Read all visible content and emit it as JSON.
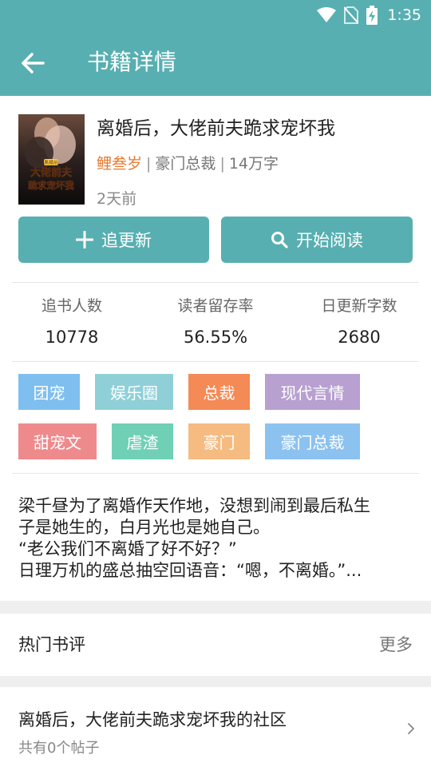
{
  "status": {
    "time": "1:35"
  },
  "header": {
    "title": "书籍详情",
    "back_icon": "arrow-left-icon"
  },
  "book": {
    "title": "离婚后，大佬前夫跪求宠坏我",
    "author": "鲤叁岁",
    "category": "豪门总裁",
    "word_count": "14万字",
    "updated": "2天前",
    "cover": {
      "badge": "离婚后",
      "line1": "大佬前夫",
      "line2": "跪求宠坏我"
    }
  },
  "actions": {
    "follow_label": "追更新",
    "read_label": "开始阅读"
  },
  "stats": [
    {
      "label": "追书人数",
      "value": "10778"
    },
    {
      "label": "读者留存率",
      "value": "56.55%"
    },
    {
      "label": "日更新字数",
      "value": "2680"
    }
  ],
  "tags": [
    {
      "label": "团宠",
      "color": "#7fbff0"
    },
    {
      "label": "娱乐圈",
      "color": "#8fd0d8"
    },
    {
      "label": "总裁",
      "color": "#f48a55"
    },
    {
      "label": "现代言情",
      "color": "#b8a0d0"
    },
    {
      "label": "甜宠文",
      "color": "#ef8a8c"
    },
    {
      "label": "虐渣",
      "color": "#6fd0b6"
    },
    {
      "label": "豪门",
      "color": "#f5bb80"
    },
    {
      "label": "豪门总裁",
      "color": "#8cc2ef"
    }
  ],
  "synopsis": {
    "lines": [
      "梁千昼为了离婚作天作地，没想到闹到最后私生",
      "子是她生的，白月光也是她自己。",
      "“老公我们不离婚了好不好？”",
      "日理万机的盛总抽空回语音：“嗯，不离婚。”..."
    ]
  },
  "reviews": {
    "title": "热门书评",
    "more_label": "更多"
  },
  "community": {
    "title": "离婚后，大佬前夫跪求宠坏我的社区",
    "subtitle": "共有0个帖子"
  },
  "colors": {
    "primary": "#58afb1",
    "author": "#e57a30"
  }
}
